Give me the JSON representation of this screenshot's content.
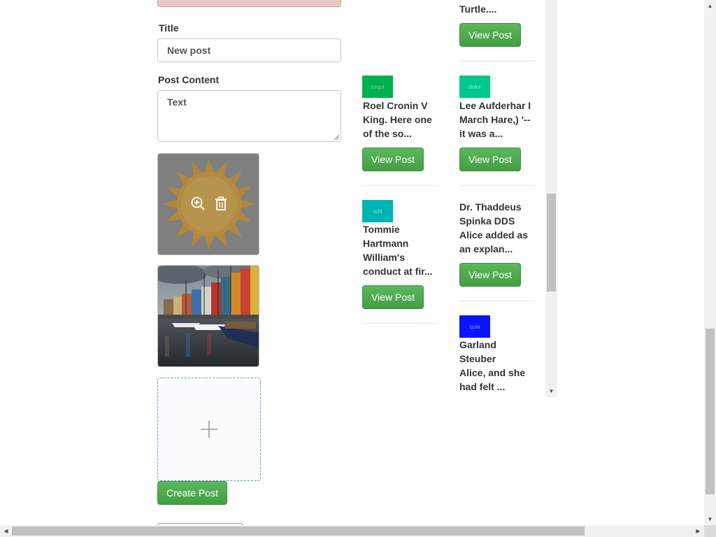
{
  "form": {
    "title_label": "Title",
    "title_value": "New post",
    "content_label": "Post Content",
    "content_value": "Text",
    "create_button": "Create Post"
  },
  "posts": [
    {
      "id": "p0",
      "swatch_text": "",
      "swatch_color": "",
      "text_lines": [
        "Turtle...."
      ],
      "button": "View Post"
    },
    {
      "id": "p1",
      "swatch_text": "sequi",
      "swatch_color": "#00b04f",
      "text_lines": [
        "Roel Cronin V",
        "King. Here one",
        "of the so..."
      ],
      "button": "View Post"
    },
    {
      "id": "p2",
      "swatch_text": "dolor",
      "swatch_color": "#00c88c",
      "text_lines": [
        "Lee Aufderhar I",
        "March Hare,) '--",
        "it was a..."
      ],
      "button": "View Post"
    },
    {
      "id": "p3",
      "swatch_text": "odit",
      "swatch_color": "#00b4b4",
      "text_lines": [
        "Tommie",
        "Hartmann",
        "William's",
        "conduct at fir..."
      ],
      "button": "View Post"
    },
    {
      "id": "p4",
      "swatch_text": "",
      "swatch_color": "",
      "text_lines": [
        "Dr. Thaddeus",
        "Spinka DDS",
        "Alice added as",
        "an explan..."
      ],
      "button": "View Post"
    },
    {
      "id": "p5",
      "swatch_text": "quia",
      "swatch_color": "#0a14ff",
      "text_lines": [
        "Garland",
        "Steuber",
        "Alice, and she",
        "had felt ..."
      ],
      "button": ""
    }
  ],
  "colors": {
    "button_green": "#5cb85c",
    "upload_border": "#5b9bd5",
    "alert_bg": "#ebc8c8"
  },
  "icons": {
    "preview": "zoom-in-icon",
    "delete": "trash-icon",
    "upload": "plus-icon"
  }
}
